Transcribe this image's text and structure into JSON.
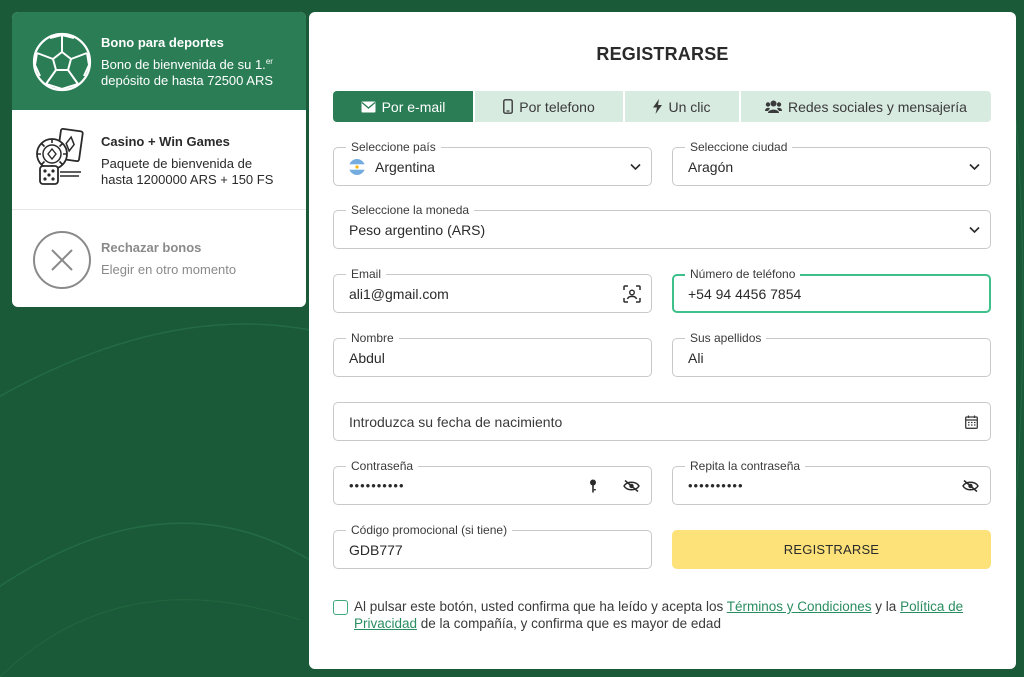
{
  "bonuses": {
    "sports": {
      "title": "Bono para deportes",
      "desc_line1": "Bono de bienvenida de su 1.",
      "desc_sup": "er",
      "desc_line2": "depósito de hasta 72500 ARS",
      "icon": "soccer-ball-icon"
    },
    "casino": {
      "title": "Casino + Win Games",
      "desc_line1": "Paquete de bienvenida de",
      "desc_line2": "hasta 1200000 ARS + 150 FS",
      "icon": "casino-chips-cards-dice-icon"
    },
    "reject": {
      "title": "Rechazar bonos",
      "desc": "Elegir en otro momento",
      "icon": "close-circle-icon"
    }
  },
  "form": {
    "title": "REGISTRARSE",
    "tabs": [
      {
        "label": "Por e-mail",
        "icon": "envelope-icon",
        "active": true
      },
      {
        "label": "Por telefono",
        "icon": "phone-icon",
        "active": false
      },
      {
        "label": "Un clic",
        "icon": "lightning-icon",
        "active": false
      },
      {
        "label": "Redes sociales y mensajería",
        "icon": "users-icon",
        "active": false
      }
    ],
    "country": {
      "label": "Seleccione país",
      "value": "Argentina"
    },
    "city": {
      "label": "Seleccione ciudad",
      "value": "Aragón"
    },
    "currency": {
      "label": "Seleccione la moneda",
      "value": "Peso argentino (ARS)"
    },
    "email": {
      "label": "Email",
      "value": "ali1@gmail.com"
    },
    "phone": {
      "label": "Número de teléfono",
      "value": "+54 94 4456 7854"
    },
    "first_name": {
      "label": "Nombre",
      "value": "Abdul"
    },
    "last_name": {
      "label": "Sus apellidos",
      "value": "Ali"
    },
    "birthdate": {
      "placeholder": "Introduzca su fecha de nacimiento"
    },
    "password": {
      "label": "Contraseña",
      "value": "••••••••••"
    },
    "password_repeat": {
      "label": "Repita la contraseña",
      "value": "••••••••••"
    },
    "promo": {
      "label": "Código promocional (si tiene)",
      "value": "GDB777"
    },
    "submit_label": "REGISTRARSE",
    "consent": {
      "text_before": "Al pulsar este botón, usted confirma que ha leído y acepta los ",
      "terms_link": "Términos y Condiciones",
      "text_middle": " y la ",
      "privacy_link": "Política de Privacidad",
      "text_after": " de la compañía, y confirma que es mayor de edad",
      "checked": false
    }
  },
  "colors": {
    "background": "#1a5a38",
    "brand_green": "#2a7d55",
    "tab_inactive": "#d8ebe1",
    "submit_yellow": "#fde27a",
    "focus_border": "#3fbf8a",
    "link_green": "#2a8d60"
  }
}
